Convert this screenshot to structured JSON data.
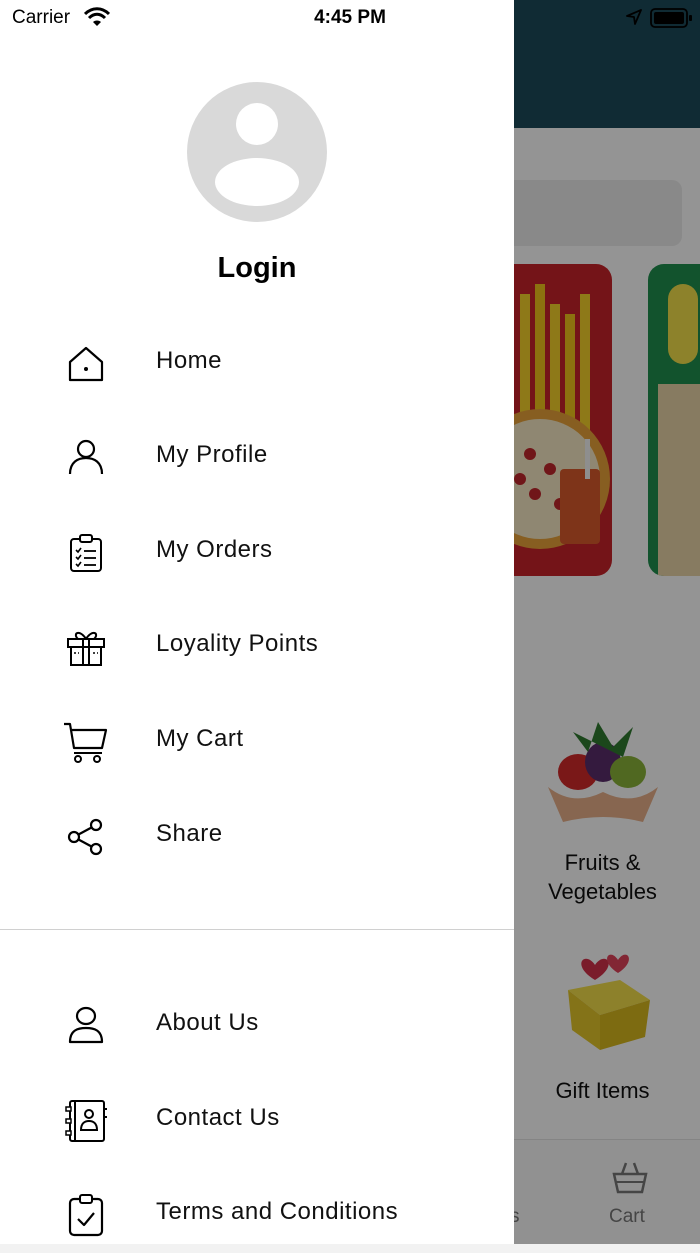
{
  "status_bar": {
    "carrier": "Carrier",
    "time": "4:45 PM"
  },
  "drawer": {
    "login_label": "Login",
    "menu": [
      {
        "label": "Home",
        "icon": "home-icon"
      },
      {
        "label": "My Profile",
        "icon": "person-icon"
      },
      {
        "label": "My Orders",
        "icon": "clipboard-list-icon"
      },
      {
        "label": "Loyality Points",
        "icon": "gift-icon"
      },
      {
        "label": "My Cart",
        "icon": "cart-icon"
      },
      {
        "label": "Share",
        "icon": "share-icon"
      }
    ],
    "secondary_menu": [
      {
        "label": "About Us",
        "icon": "person-outline-icon"
      },
      {
        "label": "Contact Us",
        "icon": "contact-book-icon"
      },
      {
        "label": "Terms and Conditions",
        "icon": "clipboard-check-icon"
      }
    ]
  },
  "background": {
    "categories": [
      {
        "label": "Fruits &\nVegetables"
      },
      {
        "label": "Gift Items"
      }
    ],
    "tabs": [
      {
        "label": "s"
      },
      {
        "label": "Cart"
      }
    ]
  }
}
